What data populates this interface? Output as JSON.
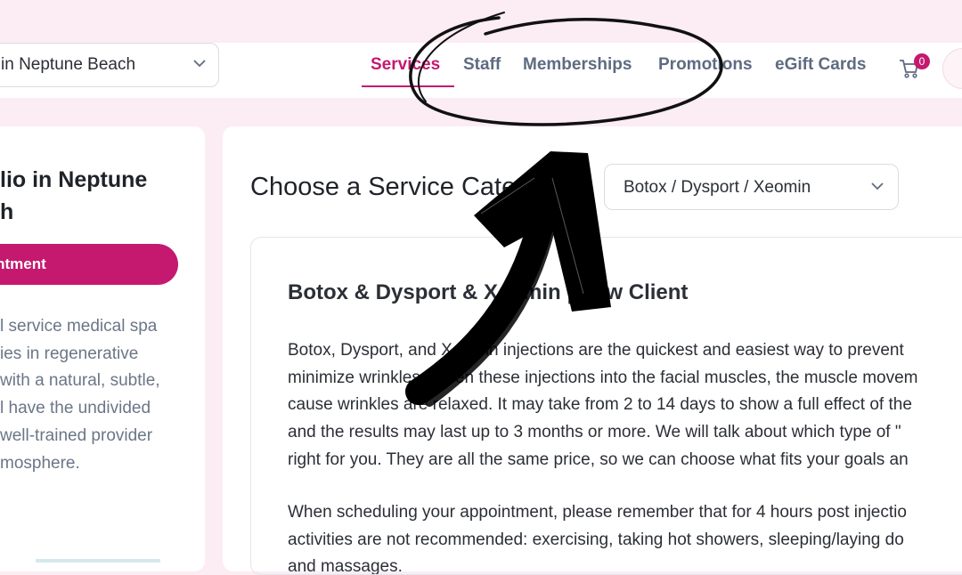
{
  "header": {
    "location": "in Neptune Beach",
    "nav": [
      "Services",
      "Staff",
      "Memberships",
      "Promotions",
      "eGift Cards"
    ],
    "active": "Services",
    "cart_count": "0"
  },
  "sidebar": {
    "studio_lines": [
      "lio in Neptune",
      "h"
    ],
    "book_button": "pintment",
    "description_lines": [
      "l service medical spa",
      "ies in regenerative",
      "with a natural, subtle,",
      "l have the undivided",
      "well-trained provider",
      "mosphere."
    ]
  },
  "main": {
    "heading": "Choose a Service Cate",
    "category_value": "Botox / Dysport / Xeomin",
    "service_title": "Botox & Dysport & Xeomin | New Client",
    "paragraph1": [
      "Botox, Dysport, and Xeomin injections are the quickest and easiest way to prevent",
      "minimize wrinkles. When these injections into the facial muscles, the muscle movem",
      "cause wrinkles are relaxed. It may take from 2 to 14 days to show a full effect of the",
      "and the results may last up to 3 months or more. We will talk about which type of \"",
      "right for you. They are all the same price, so we can choose what fits your goals an"
    ],
    "paragraph2": [
      "When scheduling your appointment, please remember that for 4 hours post injectio",
      "activities are not recommended: exercising, taking hot showers, sleeping/laying do",
      "and massages."
    ]
  },
  "icons": {
    "location_chevron": "chevron-down-icon",
    "category_chevron": "chevron-down-icon",
    "cart": "cart-icon"
  },
  "colors": {
    "accent": "#c4196f",
    "page_background": "#fcecf3",
    "nav_text": "#5e6b80"
  }
}
